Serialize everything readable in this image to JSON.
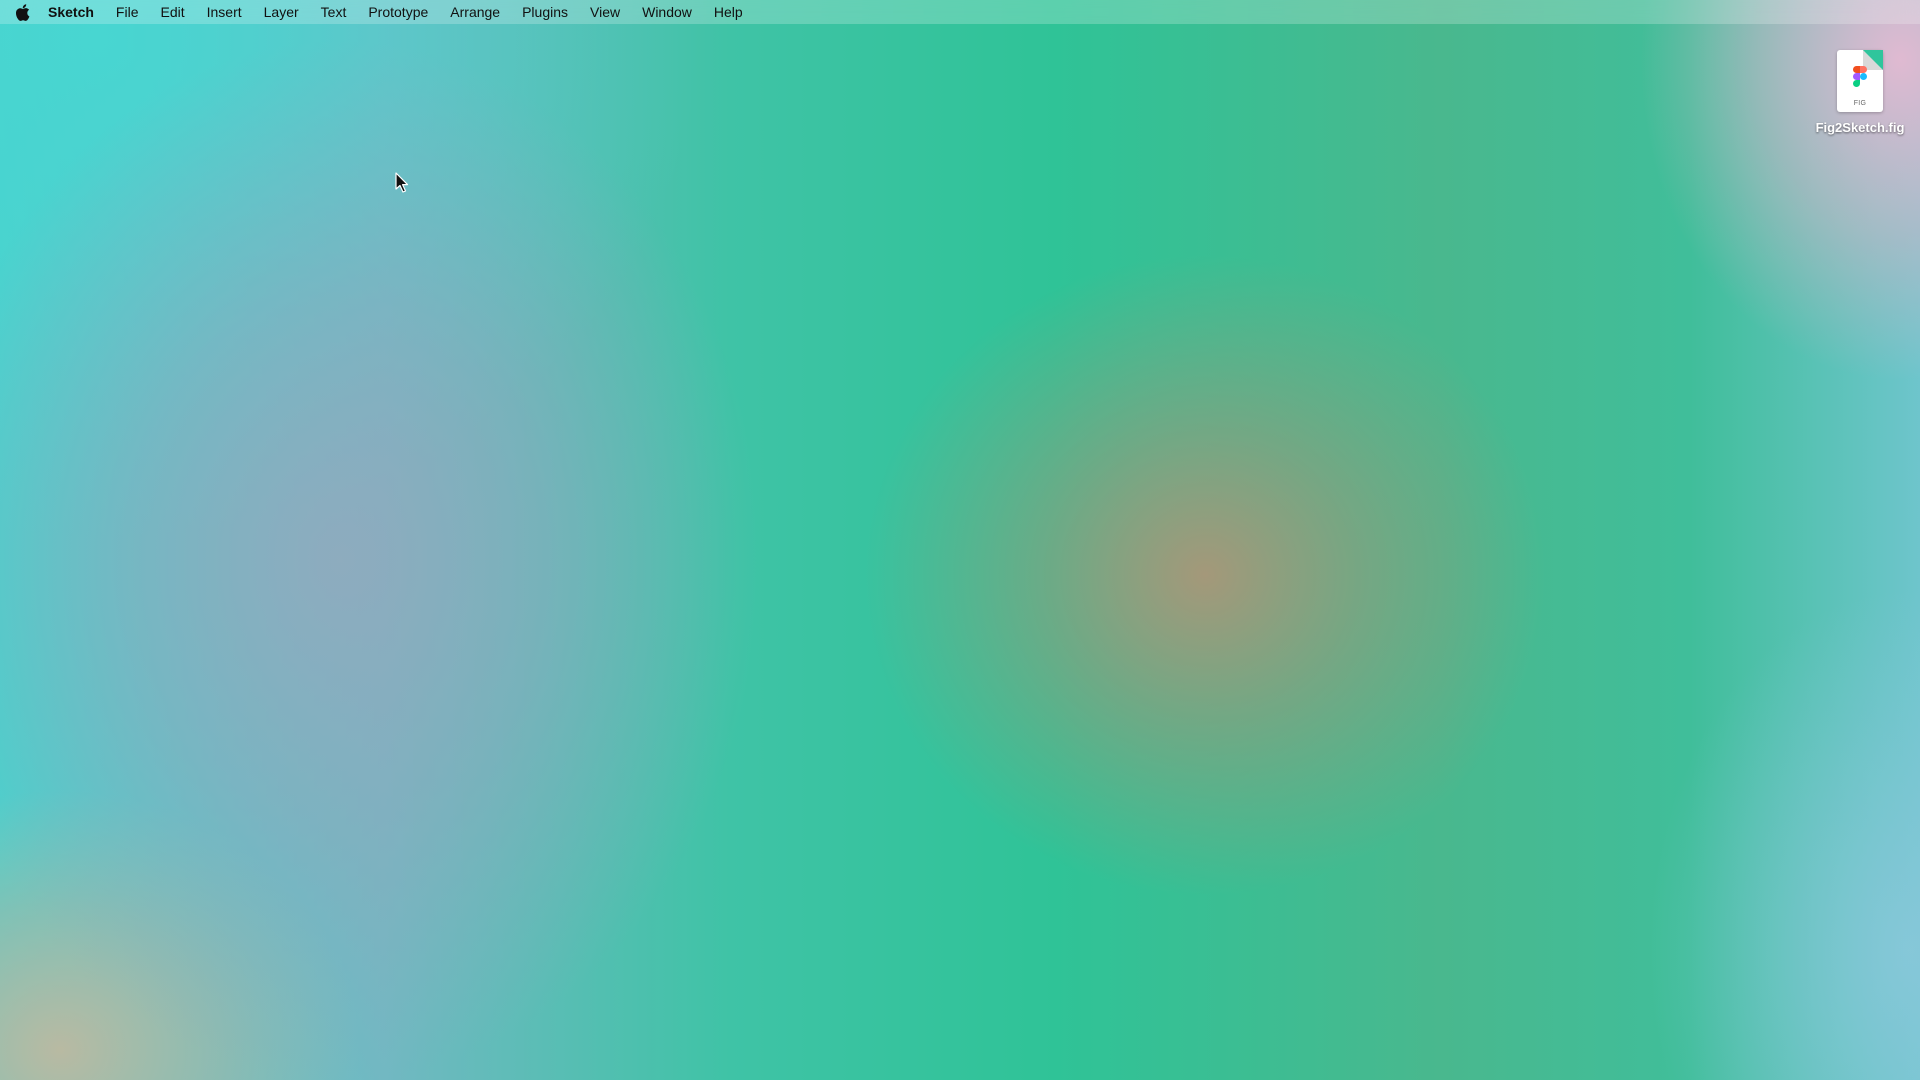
{
  "menubar": {
    "apple_icon": "apple-logo-icon",
    "app_name": "Sketch",
    "items": [
      {
        "label": "File"
      },
      {
        "label": "Edit"
      },
      {
        "label": "Insert"
      },
      {
        "label": "Layer"
      },
      {
        "label": "Text"
      },
      {
        "label": "Prototype"
      },
      {
        "label": "Arrange"
      },
      {
        "label": "Plugins"
      },
      {
        "label": "View"
      },
      {
        "label": "Window"
      },
      {
        "label": "Help"
      }
    ]
  },
  "desktop": {
    "file": {
      "icon": "figma-file-icon",
      "extension_badge": "FIG",
      "name": "Fig2Sketch.fig"
    }
  },
  "colors": {
    "menubar_text": "#111111",
    "figma_red": "#f24e1e",
    "figma_orange": "#ff7262",
    "figma_purple": "#a259ff",
    "figma_blue": "#1abcfe",
    "figma_green": "#0acf83"
  }
}
